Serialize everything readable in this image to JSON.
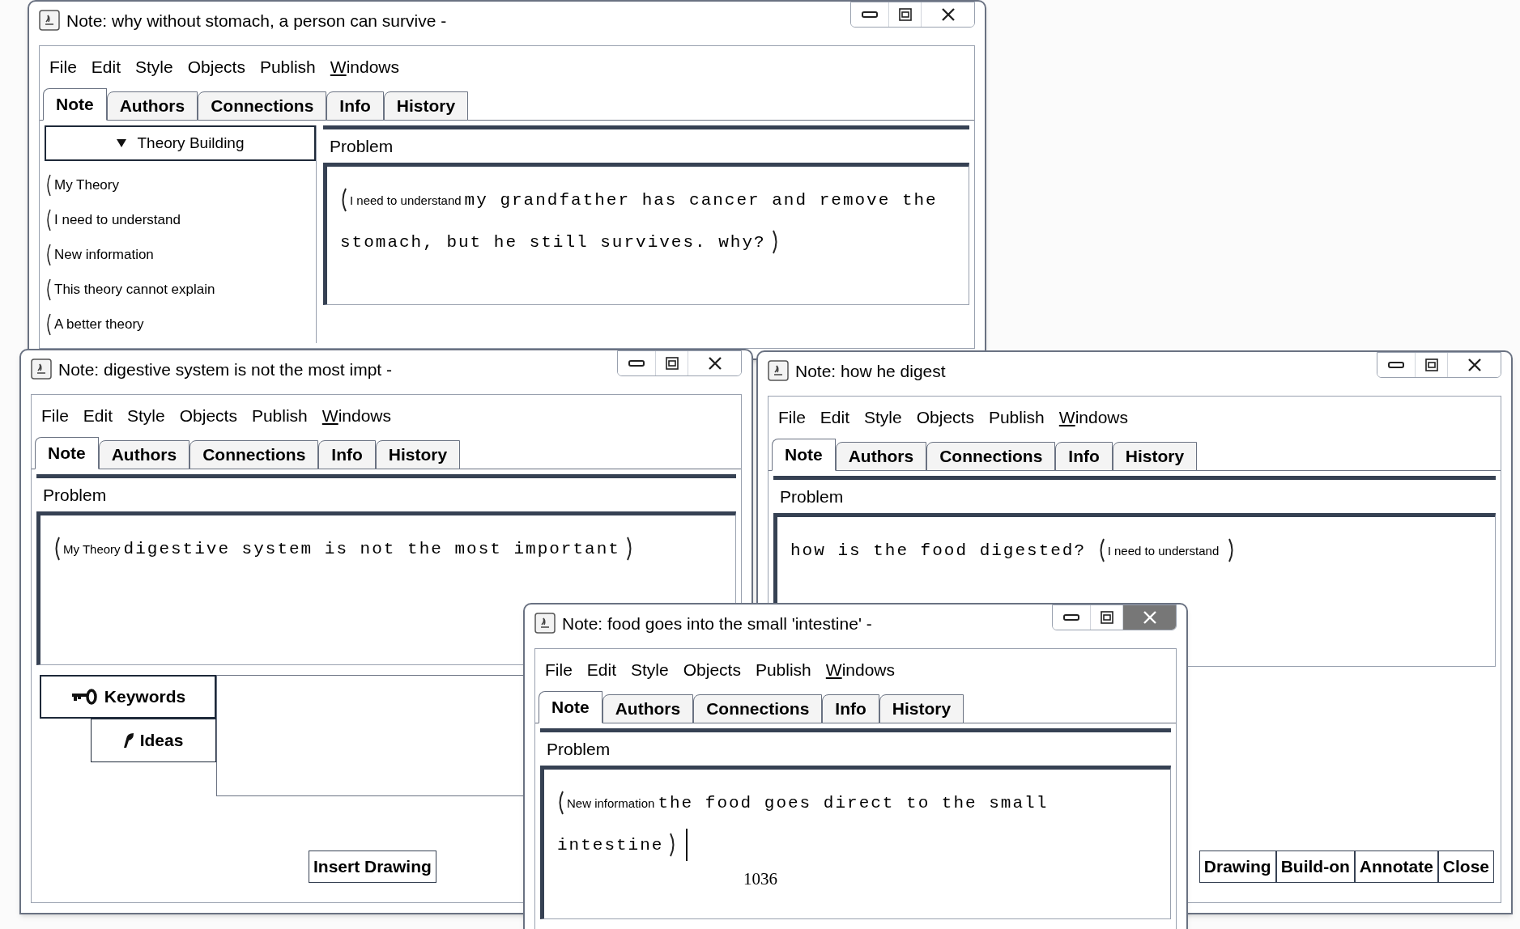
{
  "windows": [
    {
      "title": "Note: why without stomach, a person can survive -",
      "active": false,
      "menu": [
        {
          "label": "File",
          "mnemonic": false
        },
        {
          "label": "Edit",
          "mnemonic": false
        },
        {
          "label": "Style",
          "mnemonic": false
        },
        {
          "label": "Objects",
          "mnemonic": false
        },
        {
          "label": "Publish",
          "mnemonic": false
        },
        {
          "label": "Windows",
          "mnemonic": true
        }
      ],
      "tabs": [
        {
          "label": "Note",
          "selected": true
        },
        {
          "label": "Authors",
          "selected": false
        },
        {
          "label": "Connections",
          "selected": false
        },
        {
          "label": "Info",
          "selected": false
        },
        {
          "label": "History",
          "selected": false
        }
      ],
      "sidebar": {
        "heading": "Theory Building",
        "expanded": true,
        "items": [
          "My Theory",
          "I need to understand",
          "New information",
          "This theory cannot explain",
          "A better theory"
        ]
      },
      "section": "Problem",
      "text": [
        {
          "kind": "scaffold",
          "label": "I need to understand",
          "text": "my grandfather has cancer and remove the stomach, but he still survives. why?"
        }
      ]
    },
    {
      "title": "Note: digestive system is not the most impt -",
      "active": false,
      "menu": [
        {
          "label": "File",
          "mnemonic": false
        },
        {
          "label": "Edit",
          "mnemonic": false
        },
        {
          "label": "Style",
          "mnemonic": false
        },
        {
          "label": "Objects",
          "mnemonic": false
        },
        {
          "label": "Publish",
          "mnemonic": false
        },
        {
          "label": "Windows",
          "mnemonic": true
        }
      ],
      "tabs": [
        {
          "label": "Note",
          "selected": true
        },
        {
          "label": "Authors",
          "selected": false
        },
        {
          "label": "Connections",
          "selected": false
        },
        {
          "label": "Info",
          "selected": false
        },
        {
          "label": "History",
          "selected": false
        }
      ],
      "section": "Problem",
      "text": [
        {
          "kind": "scaffold",
          "label": "My Theory",
          "text": "digestive system is not the most important"
        }
      ],
      "keywords": [
        {
          "kind": "keywords",
          "label": "Keywords",
          "selected": true
        },
        {
          "kind": "ideas",
          "label": "Ideas",
          "selected": false
        }
      ],
      "buttons": [
        "Insert Drawing"
      ]
    },
    {
      "title": "Note: how he digest",
      "active": false,
      "menu": [
        {
          "label": "File",
          "mnemonic": false
        },
        {
          "label": "Edit",
          "mnemonic": false
        },
        {
          "label": "Style",
          "mnemonic": false
        },
        {
          "label": "Objects",
          "mnemonic": false
        },
        {
          "label": "Publish",
          "mnemonic": false
        },
        {
          "label": "Windows",
          "mnemonic": true
        }
      ],
      "tabs": [
        {
          "label": "Note",
          "selected": true
        },
        {
          "label": "Authors",
          "selected": false
        },
        {
          "label": "Connections",
          "selected": false
        },
        {
          "label": "Info",
          "selected": false
        },
        {
          "label": "History",
          "selected": false
        }
      ],
      "section": "Problem",
      "text": [
        {
          "kind": "plain",
          "text": "how is the food digested?"
        },
        {
          "kind": "scaffold",
          "label": "I need to understand"
        }
      ],
      "buttons": [
        "Drawing",
        "Build-on",
        "Annotate",
        "Close"
      ]
    },
    {
      "title": "Note: food goes into the small 'intestine' -",
      "active": true,
      "menu": [
        {
          "label": "File",
          "mnemonic": false
        },
        {
          "label": "Edit",
          "mnemonic": false
        },
        {
          "label": "Style",
          "mnemonic": false
        },
        {
          "label": "Objects",
          "mnemonic": false
        },
        {
          "label": "Publish",
          "mnemonic": false
        },
        {
          "label": "Windows",
          "mnemonic": true
        }
      ],
      "tabs": [
        {
          "label": "Note",
          "selected": true
        },
        {
          "label": "Authors",
          "selected": false
        },
        {
          "label": "Connections",
          "selected": false
        },
        {
          "label": "Info",
          "selected": false
        },
        {
          "label": "History",
          "selected": false
        }
      ],
      "section": "Problem",
      "text": [
        {
          "kind": "scaffold",
          "label": "New information",
          "text": "the food goes direct to the small intestine"
        }
      ],
      "caret": true,
      "counter": "1036"
    }
  ]
}
